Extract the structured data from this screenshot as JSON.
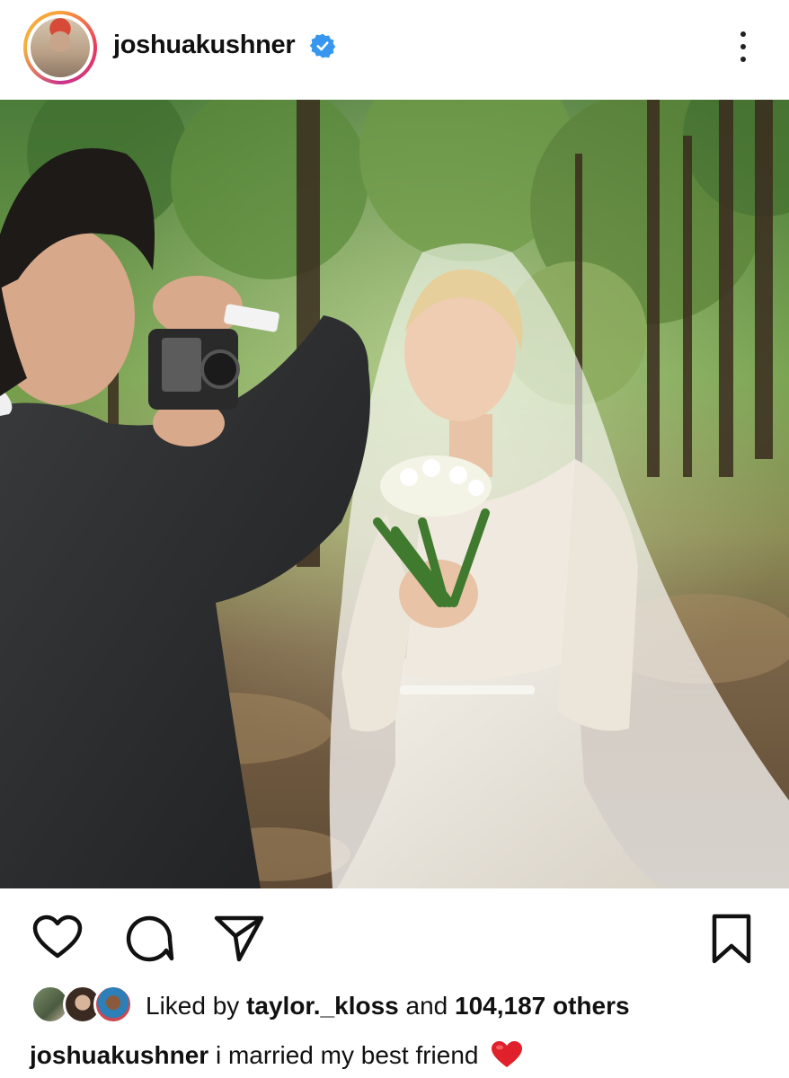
{
  "post": {
    "username": "joshuakushner",
    "verified": true,
    "avatar_icon": "profile-avatar",
    "more_icon": "more-vertical-icon",
    "image_alt": "Wedding photo in a forest: groom photographing bride in veil holding a bouquet",
    "actions": {
      "like_icon": "heart-icon",
      "comment_icon": "comment-icon",
      "share_icon": "send-icon",
      "save_icon": "bookmark-icon"
    },
    "likes": {
      "prefix": "Liked by",
      "liker": "taylor._kloss",
      "joiner": "and",
      "count": "104,187 others"
    },
    "caption": {
      "username": "joshuakushner",
      "text": "i married my best friend",
      "emoji": "red-heart"
    }
  },
  "colors": {
    "verified_blue": "#3797f0",
    "heart_red": "#e0202a",
    "text": "#111111"
  }
}
